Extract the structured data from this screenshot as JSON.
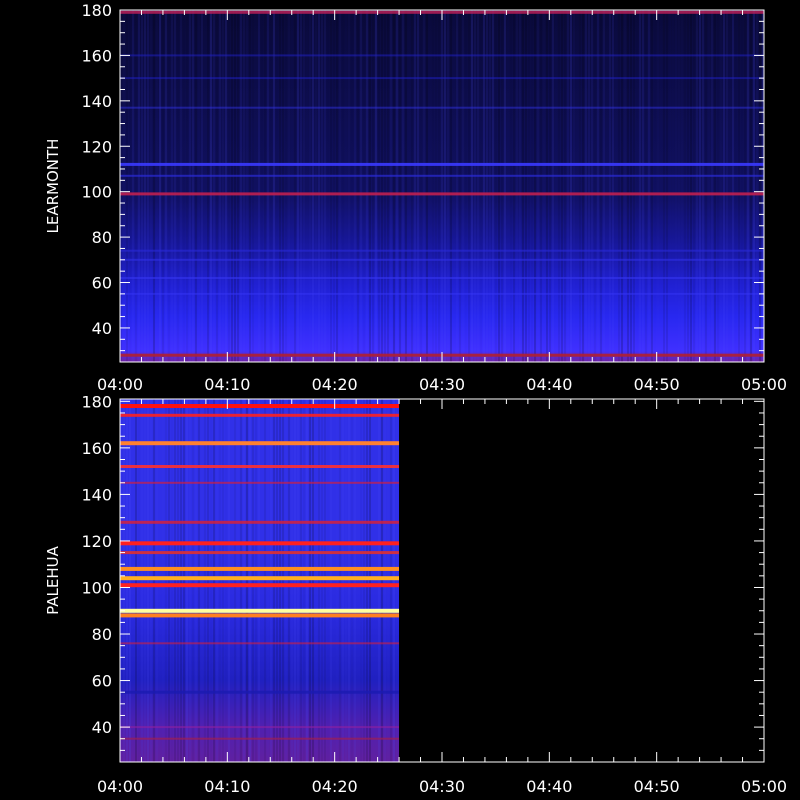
{
  "chart_data": [
    {
      "type": "heatmap",
      "station": "LEARMONTH",
      "ylabel": "LEARMONTH",
      "ylim": [
        25,
        180
      ],
      "ytick_values": [
        40,
        60,
        80,
        100,
        120,
        140,
        160,
        180
      ],
      "ytick_labels": [
        "40",
        "60",
        "80",
        "100",
        "120",
        "140",
        "160",
        "180"
      ],
      "xtick_labels": [
        "04:00",
        "04:10",
        "04:20",
        "04:30",
        "04:40",
        "04:50",
        "05:00"
      ],
      "xlim_minutes": [
        0,
        60
      ],
      "data_end_minute": 60,
      "background_color": "#0a0a40",
      "bands": [
        {
          "y": 179,
          "color": "#c0205a",
          "strength": 0.8
        },
        {
          "y": 160,
          "color": "#2020c8",
          "strength": 0.5
        },
        {
          "y": 150,
          "color": "#2020c8",
          "strength": 0.5
        },
        {
          "y": 137,
          "color": "#3030e0",
          "strength": 0.5
        },
        {
          "y": 112,
          "color": "#3a3aff",
          "strength": 0.9
        },
        {
          "y": 107,
          "color": "#2b2bd8",
          "strength": 0.7
        },
        {
          "y": 99,
          "color": "#c02050",
          "strength": 0.9
        },
        {
          "y": 74,
          "color": "#2a2ad8",
          "strength": 0.6
        },
        {
          "y": 70,
          "color": "#3030e8",
          "strength": 0.6
        },
        {
          "y": 62,
          "color": "#3535f0",
          "strength": 0.6
        },
        {
          "y": 55,
          "color": "#3535f5",
          "strength": 0.5
        },
        {
          "y": 28,
          "color": "#b02030",
          "strength": 0.9
        }
      ],
      "gradient_stops": [
        {
          "y": 180,
          "color": "#0a0a3a"
        },
        {
          "y": 100,
          "color": "#101060"
        },
        {
          "y": 75,
          "color": "#1818a0"
        },
        {
          "y": 60,
          "color": "#2020d0"
        },
        {
          "y": 45,
          "color": "#2828f0"
        },
        {
          "y": 30,
          "color": "#4030ff"
        },
        {
          "y": 25,
          "color": "#7020a0"
        }
      ]
    },
    {
      "type": "heatmap",
      "station": "PALEHUA",
      "ylabel": "PALEHUA",
      "ylim": [
        25,
        181
      ],
      "ytick_values": [
        40,
        60,
        80,
        100,
        120,
        140,
        160,
        180
      ],
      "ytick_labels": [
        "40",
        "60",
        "80",
        "100",
        "120",
        "140",
        "160",
        "180"
      ],
      "xtick_labels": [
        "04:00",
        "04:10",
        "04:20",
        "04:30",
        "04:40",
        "04:50",
        "05:00"
      ],
      "xlim_minutes": [
        0,
        60
      ],
      "data_end_minute": 26,
      "background_color": "#2828e0",
      "bands": [
        {
          "y": 178,
          "color": "#ff1010",
          "strength": 1.0
        },
        {
          "y": 174,
          "color": "#ff2020",
          "strength": 0.9
        },
        {
          "y": 162,
          "color": "#ff8030",
          "strength": 1.0
        },
        {
          "y": 152,
          "color": "#ff3030",
          "strength": 0.9
        },
        {
          "y": 145,
          "color": "#d02040",
          "strength": 0.7
        },
        {
          "y": 128,
          "color": "#e02030",
          "strength": 0.8
        },
        {
          "y": 119,
          "color": "#ff2020",
          "strength": 1.0
        },
        {
          "y": 115,
          "color": "#e03030",
          "strength": 0.9
        },
        {
          "y": 108,
          "color": "#ff9020",
          "strength": 1.0
        },
        {
          "y": 104,
          "color": "#ffb020",
          "strength": 1.0
        },
        {
          "y": 101,
          "color": "#ff2020",
          "strength": 1.0
        },
        {
          "y": 90,
          "color": "#ffffa0",
          "strength": 1.0
        },
        {
          "y": 88,
          "color": "#ff8020",
          "strength": 1.0
        },
        {
          "y": 76,
          "color": "#d02040",
          "strength": 0.6
        },
        {
          "y": 55,
          "color": "#1a1ab0",
          "strength": 0.8
        },
        {
          "y": 40,
          "color": "#9020a0",
          "strength": 0.6
        },
        {
          "y": 35,
          "color": "#a02050",
          "strength": 0.7
        }
      ],
      "gradient_stops": [
        {
          "y": 181,
          "color": "#3030e8"
        },
        {
          "y": 120,
          "color": "#3030e8"
        },
        {
          "y": 90,
          "color": "#2a2ae0"
        },
        {
          "y": 60,
          "color": "#2020c0"
        },
        {
          "y": 40,
          "color": "#5020b0"
        },
        {
          "y": 25,
          "color": "#6020a0"
        }
      ]
    }
  ]
}
